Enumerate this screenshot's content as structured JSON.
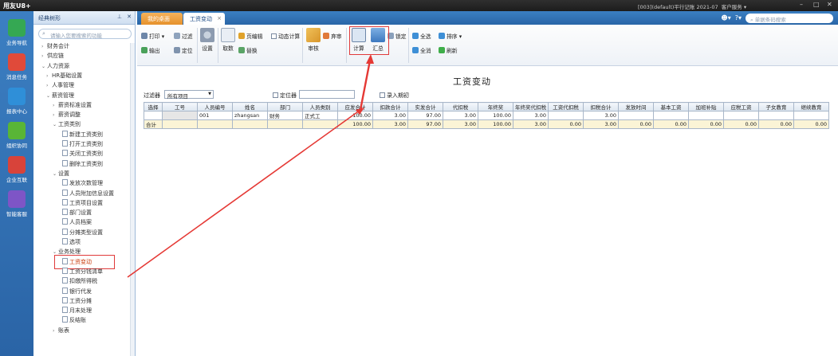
{
  "titlebar": {
    "app": "用友U8+",
    "account": "[003](default)平行记账 2021-07",
    "client": "客户服务 ▾",
    "min": "–",
    "max": "□",
    "close": "✕"
  },
  "leftnav": [
    {
      "label": "业务导航",
      "icon": "business-nav-icon",
      "color": "#35a853"
    },
    {
      "label": "消息任务",
      "icon": "message-task-icon",
      "color": "#e04a3a"
    },
    {
      "label": "报表中心",
      "icon": "report-center-icon",
      "color": "#2f8fd8"
    },
    {
      "label": "组织协同",
      "icon": "org-collab-icon",
      "color": "#59b536"
    },
    {
      "label": "企业互联",
      "icon": "enterprise-link-icon",
      "color": "#d8433a"
    },
    {
      "label": "智能客服",
      "icon": "smart-service-icon",
      "color": "#7e55c6"
    }
  ],
  "tree": {
    "header": "经典树形",
    "search_placeholder": "请输入您要搜索的功能",
    "nodes": [
      {
        "t": "财务会计",
        "lv": 1,
        "ar": "›"
      },
      {
        "t": "供应链",
        "lv": 1,
        "ar": "›"
      },
      {
        "t": "人力资源",
        "lv": 1,
        "ar": "⌄"
      },
      {
        "t": "HR基础设置",
        "lv": 2,
        "ar": "›"
      },
      {
        "t": "人事管理",
        "lv": 2,
        "ar": "›"
      },
      {
        "t": "薪资管理",
        "lv": 2,
        "ar": "⌄"
      },
      {
        "t": "薪资标准设置",
        "lv": 3,
        "ar": "›"
      },
      {
        "t": "薪资调整",
        "lv": 3,
        "ar": "›"
      },
      {
        "t": "工资类别",
        "lv": 3,
        "ar": "⌄"
      },
      {
        "t": "新建工资类别",
        "lv": 4,
        "doc": true
      },
      {
        "t": "打开工资类别",
        "lv": 4,
        "doc": true
      },
      {
        "t": "关闭工资类别",
        "lv": 4,
        "doc": true
      },
      {
        "t": "删除工资类别",
        "lv": 4,
        "doc": true
      },
      {
        "t": "设置",
        "lv": 3,
        "ar": "⌄"
      },
      {
        "t": "发放次数管理",
        "lv": 4,
        "doc": true
      },
      {
        "t": "人员附加信息设置",
        "lv": 4,
        "doc": true
      },
      {
        "t": "工资项目设置",
        "lv": 4,
        "doc": true
      },
      {
        "t": "部门设置",
        "lv": 4,
        "doc": true
      },
      {
        "t": "人员档案",
        "lv": 4,
        "doc": true
      },
      {
        "t": "分摊类型设置",
        "lv": 4,
        "doc": true
      },
      {
        "t": "选项",
        "lv": 4,
        "doc": true
      },
      {
        "t": "业务处理",
        "lv": 3,
        "ar": "⌄"
      },
      {
        "t": "工资变动",
        "lv": 4,
        "doc": true,
        "sel": true
      },
      {
        "t": "工资分钱清单",
        "lv": 4,
        "doc": true
      },
      {
        "t": "扣缴所得税",
        "lv": 4,
        "doc": true
      },
      {
        "t": "银行代发",
        "lv": 4,
        "doc": true
      },
      {
        "t": "工资分摊",
        "lv": 4,
        "doc": true
      },
      {
        "t": "月末处理",
        "lv": 4,
        "doc": true
      },
      {
        "t": "反结账",
        "lv": 4,
        "doc": true
      },
      {
        "t": "账表",
        "lv": 3,
        "ar": "›"
      }
    ]
  },
  "tabs": {
    "home": "我的桌面",
    "active": "工资变动",
    "close": "×"
  },
  "topright": {
    "search_placeholder": "单据条码搜索"
  },
  "toolbar": {
    "print": "打印",
    "filter": "过滤",
    "output": "输出",
    "locate": "定位",
    "settings": "设置",
    "fetch": "取数",
    "edit_page": "页编辑",
    "dynamic_calc": "动态计算",
    "replace": "替换",
    "audit": "审核",
    "abandon": "弃审",
    "calculate": "计算",
    "summary": "汇总",
    "lock": "锁定",
    "select_all": "全选",
    "sort": "排序",
    "deselect_all": "全消",
    "refresh": "刷新"
  },
  "page": {
    "title": "工资变动",
    "filter_label": "过滤器",
    "filter_value": "所有项目",
    "locator_label": "定位器",
    "enter_period": "录入期初"
  },
  "grid": {
    "columns": [
      "选择",
      "工号",
      "人员编号",
      "姓名",
      "部门",
      "人员类别",
      "应发合计",
      "扣款合计",
      "实发合计",
      "代扣税",
      "年终奖",
      "年终奖代扣税",
      "工资代扣税",
      "扣税合计",
      "发放时间",
      "基本工资",
      "加班补贴",
      "应税工资",
      "子女教育",
      "继续教育"
    ],
    "rows": [
      [
        "",
        "",
        "001",
        "zhangsan",
        "财务",
        "正式工",
        "100.00",
        "3.00",
        "97.00",
        "3.00",
        "100.00",
        "3.00",
        "",
        "3.00",
        "",
        "",
        "",
        "",
        "",
        ""
      ]
    ],
    "total": [
      "合计",
      "",
      "",
      "",
      "",
      "",
      "100.00",
      "3.00",
      "97.00",
      "3.00",
      "100.00",
      "3.00",
      "0.00",
      "3.00",
      "0.00",
      "0.00",
      "0.00",
      "0.00",
      "0.00",
      "0.00"
    ]
  }
}
